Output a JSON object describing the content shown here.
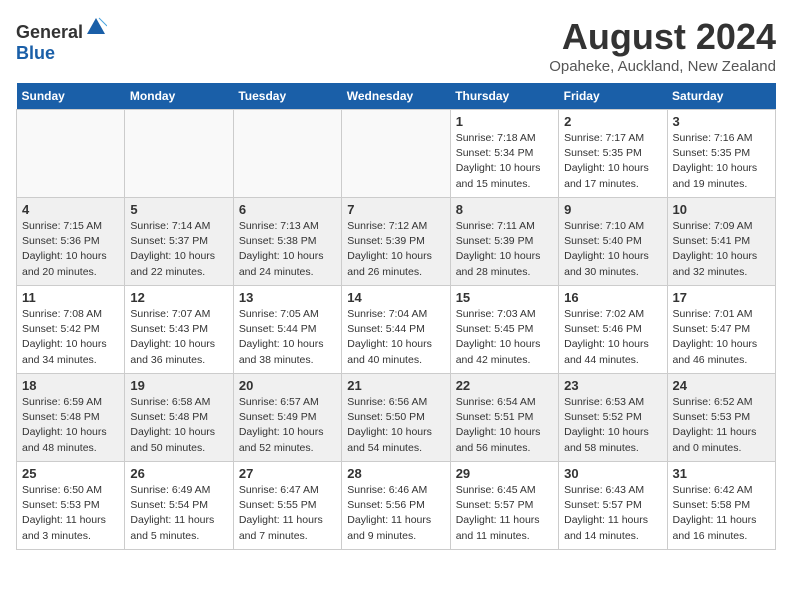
{
  "header": {
    "logo_general": "General",
    "logo_blue": "Blue",
    "title": "August 2024",
    "subtitle": "Opaheke, Auckland, New Zealand"
  },
  "days_of_week": [
    "Sunday",
    "Monday",
    "Tuesday",
    "Wednesday",
    "Thursday",
    "Friday",
    "Saturday"
  ],
  "weeks": [
    [
      {
        "day": "",
        "sunrise": "",
        "sunset": "",
        "daylight": ""
      },
      {
        "day": "",
        "sunrise": "",
        "sunset": "",
        "daylight": ""
      },
      {
        "day": "",
        "sunrise": "",
        "sunset": "",
        "daylight": ""
      },
      {
        "day": "",
        "sunrise": "",
        "sunset": "",
        "daylight": ""
      },
      {
        "day": "1",
        "sunrise": "Sunrise: 7:18 AM",
        "sunset": "Sunset: 5:34 PM",
        "daylight": "Daylight: 10 hours and 15 minutes."
      },
      {
        "day": "2",
        "sunrise": "Sunrise: 7:17 AM",
        "sunset": "Sunset: 5:35 PM",
        "daylight": "Daylight: 10 hours and 17 minutes."
      },
      {
        "day": "3",
        "sunrise": "Sunrise: 7:16 AM",
        "sunset": "Sunset: 5:35 PM",
        "daylight": "Daylight: 10 hours and 19 minutes."
      }
    ],
    [
      {
        "day": "4",
        "sunrise": "Sunrise: 7:15 AM",
        "sunset": "Sunset: 5:36 PM",
        "daylight": "Daylight: 10 hours and 20 minutes."
      },
      {
        "day": "5",
        "sunrise": "Sunrise: 7:14 AM",
        "sunset": "Sunset: 5:37 PM",
        "daylight": "Daylight: 10 hours and 22 minutes."
      },
      {
        "day": "6",
        "sunrise": "Sunrise: 7:13 AM",
        "sunset": "Sunset: 5:38 PM",
        "daylight": "Daylight: 10 hours and 24 minutes."
      },
      {
        "day": "7",
        "sunrise": "Sunrise: 7:12 AM",
        "sunset": "Sunset: 5:39 PM",
        "daylight": "Daylight: 10 hours and 26 minutes."
      },
      {
        "day": "8",
        "sunrise": "Sunrise: 7:11 AM",
        "sunset": "Sunset: 5:39 PM",
        "daylight": "Daylight: 10 hours and 28 minutes."
      },
      {
        "day": "9",
        "sunrise": "Sunrise: 7:10 AM",
        "sunset": "Sunset: 5:40 PM",
        "daylight": "Daylight: 10 hours and 30 minutes."
      },
      {
        "day": "10",
        "sunrise": "Sunrise: 7:09 AM",
        "sunset": "Sunset: 5:41 PM",
        "daylight": "Daylight: 10 hours and 32 minutes."
      }
    ],
    [
      {
        "day": "11",
        "sunrise": "Sunrise: 7:08 AM",
        "sunset": "Sunset: 5:42 PM",
        "daylight": "Daylight: 10 hours and 34 minutes."
      },
      {
        "day": "12",
        "sunrise": "Sunrise: 7:07 AM",
        "sunset": "Sunset: 5:43 PM",
        "daylight": "Daylight: 10 hours and 36 minutes."
      },
      {
        "day": "13",
        "sunrise": "Sunrise: 7:05 AM",
        "sunset": "Sunset: 5:44 PM",
        "daylight": "Daylight: 10 hours and 38 minutes."
      },
      {
        "day": "14",
        "sunrise": "Sunrise: 7:04 AM",
        "sunset": "Sunset: 5:44 PM",
        "daylight": "Daylight: 10 hours and 40 minutes."
      },
      {
        "day": "15",
        "sunrise": "Sunrise: 7:03 AM",
        "sunset": "Sunset: 5:45 PM",
        "daylight": "Daylight: 10 hours and 42 minutes."
      },
      {
        "day": "16",
        "sunrise": "Sunrise: 7:02 AM",
        "sunset": "Sunset: 5:46 PM",
        "daylight": "Daylight: 10 hours and 44 minutes."
      },
      {
        "day": "17",
        "sunrise": "Sunrise: 7:01 AM",
        "sunset": "Sunset: 5:47 PM",
        "daylight": "Daylight: 10 hours and 46 minutes."
      }
    ],
    [
      {
        "day": "18",
        "sunrise": "Sunrise: 6:59 AM",
        "sunset": "Sunset: 5:48 PM",
        "daylight": "Daylight: 10 hours and 48 minutes."
      },
      {
        "day": "19",
        "sunrise": "Sunrise: 6:58 AM",
        "sunset": "Sunset: 5:48 PM",
        "daylight": "Daylight: 10 hours and 50 minutes."
      },
      {
        "day": "20",
        "sunrise": "Sunrise: 6:57 AM",
        "sunset": "Sunset: 5:49 PM",
        "daylight": "Daylight: 10 hours and 52 minutes."
      },
      {
        "day": "21",
        "sunrise": "Sunrise: 6:56 AM",
        "sunset": "Sunset: 5:50 PM",
        "daylight": "Daylight: 10 hours and 54 minutes."
      },
      {
        "day": "22",
        "sunrise": "Sunrise: 6:54 AM",
        "sunset": "Sunset: 5:51 PM",
        "daylight": "Daylight: 10 hours and 56 minutes."
      },
      {
        "day": "23",
        "sunrise": "Sunrise: 6:53 AM",
        "sunset": "Sunset: 5:52 PM",
        "daylight": "Daylight: 10 hours and 58 minutes."
      },
      {
        "day": "24",
        "sunrise": "Sunrise: 6:52 AM",
        "sunset": "Sunset: 5:53 PM",
        "daylight": "Daylight: 11 hours and 0 minutes."
      }
    ],
    [
      {
        "day": "25",
        "sunrise": "Sunrise: 6:50 AM",
        "sunset": "Sunset: 5:53 PM",
        "daylight": "Daylight: 11 hours and 3 minutes."
      },
      {
        "day": "26",
        "sunrise": "Sunrise: 6:49 AM",
        "sunset": "Sunset: 5:54 PM",
        "daylight": "Daylight: 11 hours and 5 minutes."
      },
      {
        "day": "27",
        "sunrise": "Sunrise: 6:47 AM",
        "sunset": "Sunset: 5:55 PM",
        "daylight": "Daylight: 11 hours and 7 minutes."
      },
      {
        "day": "28",
        "sunrise": "Sunrise: 6:46 AM",
        "sunset": "Sunset: 5:56 PM",
        "daylight": "Daylight: 11 hours and 9 minutes."
      },
      {
        "day": "29",
        "sunrise": "Sunrise: 6:45 AM",
        "sunset": "Sunset: 5:57 PM",
        "daylight": "Daylight: 11 hours and 11 minutes."
      },
      {
        "day": "30",
        "sunrise": "Sunrise: 6:43 AM",
        "sunset": "Sunset: 5:57 PM",
        "daylight": "Daylight: 11 hours and 14 minutes."
      },
      {
        "day": "31",
        "sunrise": "Sunrise: 6:42 AM",
        "sunset": "Sunset: 5:58 PM",
        "daylight": "Daylight: 11 hours and 16 minutes."
      }
    ]
  ]
}
